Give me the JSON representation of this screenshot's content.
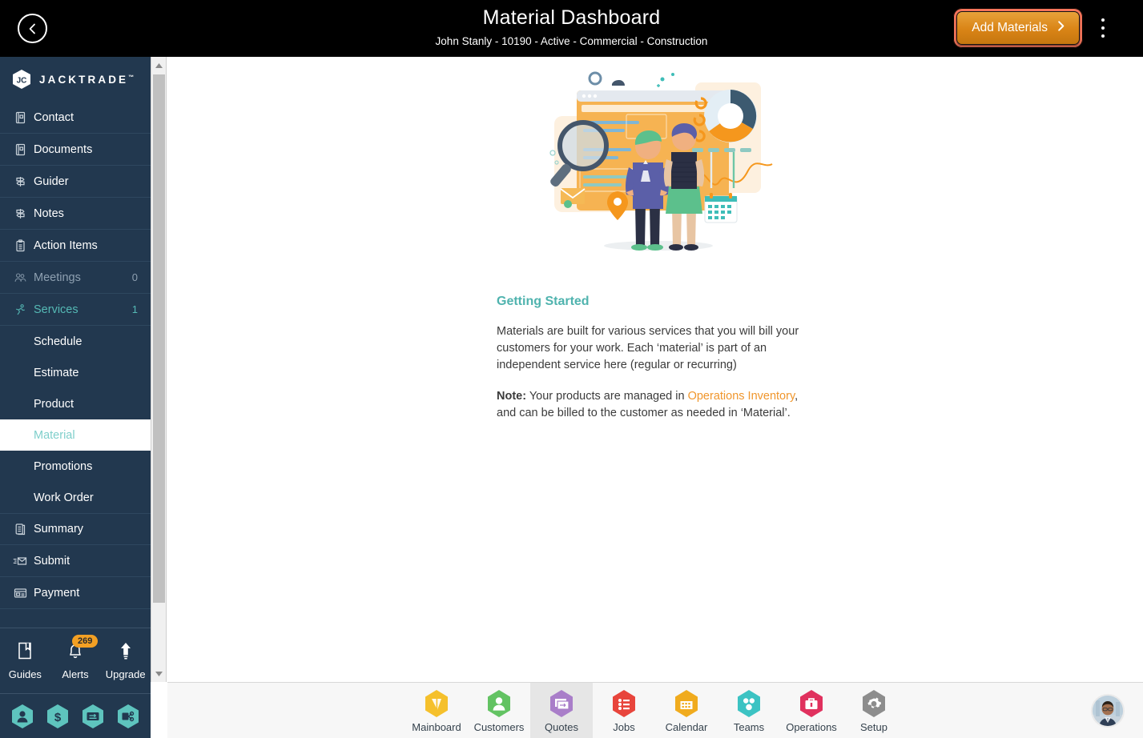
{
  "header": {
    "back_icon": "chevron-left-icon",
    "title": "Material Dashboard",
    "subtitle": "John Stanly - 10190 - Active - Commercial - Construction",
    "add_button_label": "Add Materials",
    "add_button_icon": "chevron-right-icon",
    "menu_icon": "kebab-menu-icon",
    "background": "#000000",
    "add_button_color": "#d98416",
    "add_button_ring": "#f4745a"
  },
  "sidebar": {
    "brand": "JACKTRADE",
    "brand_tm": "™",
    "brand_icon": "jacktrade-hex-logo",
    "background": "#22384f",
    "active_color": "#55b9b5",
    "items": [
      {
        "label": "Contact",
        "icon": "contact-book-icon",
        "count": "",
        "state": "normal"
      },
      {
        "label": "Documents",
        "icon": "documents-icon",
        "count": "",
        "state": "normal"
      },
      {
        "label": "Guider",
        "icon": "guidepost-icon",
        "count": "",
        "state": "normal"
      },
      {
        "label": "Notes",
        "icon": "notes-signpost-icon",
        "count": "",
        "state": "normal"
      },
      {
        "label": "Action Items",
        "icon": "clipboard-icon",
        "count": "",
        "state": "normal"
      },
      {
        "label": "Meetings",
        "icon": "meetings-icon",
        "count": "0",
        "state": "dim"
      },
      {
        "label": "Services",
        "icon": "services-icon",
        "count": "1",
        "state": "teal"
      }
    ],
    "sub_items": [
      {
        "label": "Schedule",
        "active": false
      },
      {
        "label": "Estimate",
        "active": false
      },
      {
        "label": "Product",
        "active": false
      },
      {
        "label": "Material",
        "active": true
      },
      {
        "label": "Promotions",
        "active": false
      },
      {
        "label": "Work Order",
        "active": false
      }
    ],
    "items_after": [
      {
        "label": "Summary",
        "icon": "summary-icon",
        "count": "",
        "state": "normal"
      },
      {
        "label": "Submit",
        "icon": "submit-mail-icon",
        "count": "",
        "state": "normal"
      },
      {
        "label": "Payment",
        "icon": "payment-card-icon",
        "count": "",
        "state": "normal"
      }
    ],
    "quick_actions": [
      {
        "label": "Guides",
        "icon": "book-icon",
        "badge": ""
      },
      {
        "label": "Alerts",
        "icon": "bell-icon",
        "badge": "269"
      },
      {
        "label": "Upgrade",
        "icon": "up-arrow-icon",
        "badge": ""
      }
    ],
    "hex_shortcuts": [
      {
        "icon": "person-hex-icon",
        "color": "#5ec4be"
      },
      {
        "icon": "dollar-hex-icon",
        "color": "#5ec4be"
      },
      {
        "icon": "payment-hex-icon",
        "color": "#5ec4be"
      },
      {
        "icon": "network-hex-icon",
        "color": "#5ec4be"
      }
    ],
    "alerts_badge_color": "#f3a024",
    "scrollbar": {
      "up_icon": "scroll-up-arrow",
      "down_icon": "scroll-down-arrow"
    }
  },
  "main": {
    "illustration": "dashboard-people-illustration",
    "getting_started_title": "Getting Started",
    "paragraph_1": "Materials are built for various services that you will bill your customers for your work. Each ‘material’ is part of an independent service here (regular or recurring)",
    "note_label": "Note:",
    "note_text_before": " Your products are managed in ",
    "note_link": "Operations Inventory",
    "note_text_after": ", and can be billed to the customer as needed in ‘Material’.",
    "title_color": "#4fb3ae",
    "link_color": "#f0962c"
  },
  "bottom_nav": {
    "items": [
      {
        "label": "Mainboard",
        "icon": "mainboard-hex-icon",
        "color": "#f5c02c",
        "selected": false
      },
      {
        "label": "Customers",
        "icon": "customers-hex-icon",
        "color": "#63c363",
        "selected": false
      },
      {
        "label": "Quotes",
        "icon": "quotes-hex-icon",
        "color": "#a97ec9",
        "selected": true
      },
      {
        "label": "Jobs",
        "icon": "jobs-hex-icon",
        "color": "#e8453c",
        "selected": false
      },
      {
        "label": "Calendar",
        "icon": "calendar-hex-icon",
        "color": "#f0ab1e",
        "selected": false
      },
      {
        "label": "Teams",
        "icon": "teams-hex-icon",
        "color": "#3cc3c3",
        "selected": false
      },
      {
        "label": "Operations",
        "icon": "operations-hex-icon",
        "color": "#e0315e",
        "selected": false
      },
      {
        "label": "Setup",
        "icon": "setup-hex-icon",
        "color": "#8d8d8d",
        "selected": false
      }
    ],
    "avatar": "user-avatar",
    "background": "#f7f7f7"
  }
}
